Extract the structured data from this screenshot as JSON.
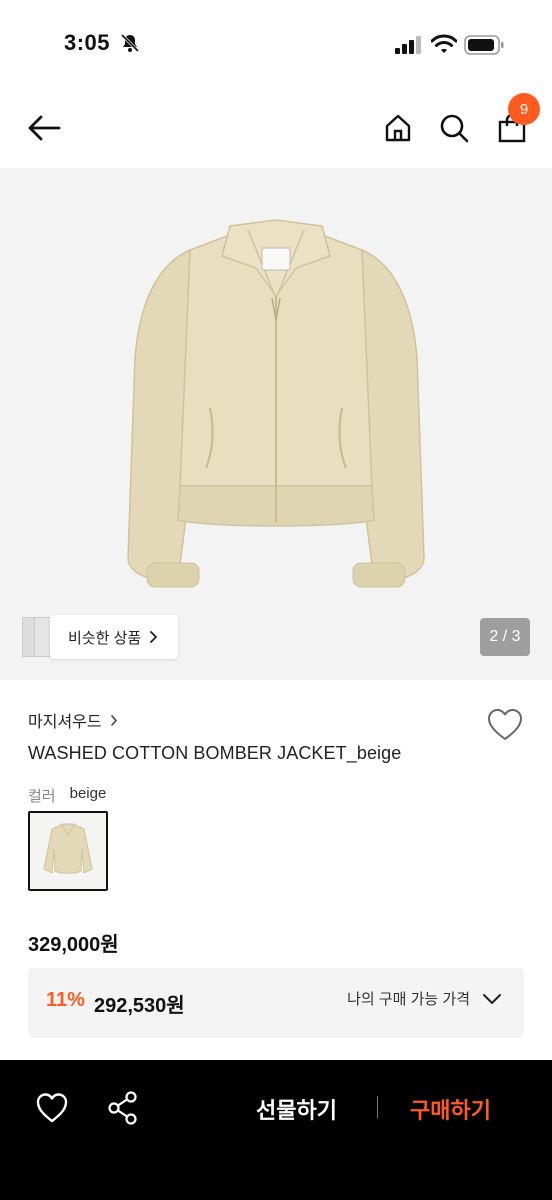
{
  "status_bar": {
    "time": "3:05",
    "icons": [
      "bell-slash-icon",
      "cellular-signal-icon",
      "wifi-icon",
      "battery-icon"
    ]
  },
  "nav": {
    "icons": [
      "arrow-left-icon",
      "home-icon",
      "search-icon",
      "shopping-bag-icon"
    ],
    "bag_badge": "9"
  },
  "gallery": {
    "similar_label": "비슷한 상품",
    "page_indicator": "2 / 3"
  },
  "product": {
    "brand": "마지셔우드",
    "name": "WASHED COTTON BOMBER JACKET_beige",
    "color_label": "컬러",
    "color_value": "beige",
    "price": "329,000원"
  },
  "discount": {
    "rate": "11%",
    "price": "292,530원",
    "my_price_label": "나의 구매 가능 가격"
  },
  "bottom_bar": {
    "gift_label": "선물하기",
    "buy_label": "구매하기"
  },
  "colors": {
    "accent": "#ff5a1f",
    "jacket": "#e6dcbc",
    "bottom_bar_bg": "#000000"
  }
}
